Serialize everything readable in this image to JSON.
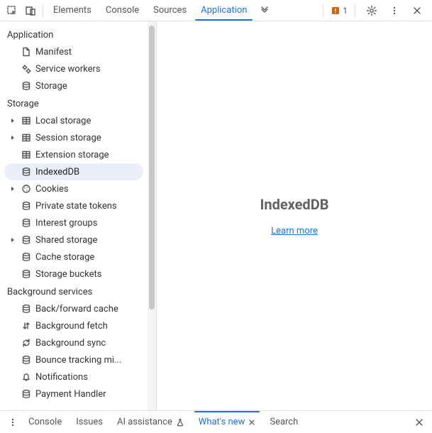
{
  "topbar": {
    "tabs": [
      "Elements",
      "Console",
      "Sources",
      "Application"
    ],
    "activeTabIndex": 3,
    "issueCount": "1"
  },
  "sidebar": {
    "groups": [
      {
        "title": "Application",
        "items": [
          {
            "label": "Manifest",
            "icon": "file",
            "expandable": false
          },
          {
            "label": "Service workers",
            "icon": "gears",
            "expandable": false
          },
          {
            "label": "Storage",
            "icon": "db",
            "expandable": false
          }
        ]
      },
      {
        "title": "Storage",
        "items": [
          {
            "label": "Local storage",
            "icon": "table",
            "expandable": true
          },
          {
            "label": "Session storage",
            "icon": "table",
            "expandable": true
          },
          {
            "label": "Extension storage",
            "icon": "table",
            "expandable": false
          },
          {
            "label": "IndexedDB",
            "icon": "db",
            "expandable": false,
            "selected": true
          },
          {
            "label": "Cookies",
            "icon": "cookie",
            "expandable": true
          },
          {
            "label": "Private state tokens",
            "icon": "db",
            "expandable": false
          },
          {
            "label": "Interest groups",
            "icon": "db",
            "expandable": false
          },
          {
            "label": "Shared storage",
            "icon": "db",
            "expandable": true
          },
          {
            "label": "Cache storage",
            "icon": "db",
            "expandable": false
          },
          {
            "label": "Storage buckets",
            "icon": "db",
            "expandable": false
          }
        ]
      },
      {
        "title": "Background services",
        "items": [
          {
            "label": "Back/forward cache",
            "icon": "db",
            "expandable": false
          },
          {
            "label": "Background fetch",
            "icon": "fetch",
            "expandable": false
          },
          {
            "label": "Background sync",
            "icon": "sync",
            "expandable": false
          },
          {
            "label": "Bounce tracking mi...",
            "icon": "db",
            "expandable": false
          },
          {
            "label": "Notifications",
            "icon": "bell",
            "expandable": false
          },
          {
            "label": "Payment Handler",
            "icon": "db",
            "expandable": false
          }
        ]
      }
    ]
  },
  "content": {
    "title": "IndexedDB",
    "linkText": "Learn more"
  },
  "drawer": {
    "tabs": [
      {
        "label": "Console",
        "active": false,
        "closable": false
      },
      {
        "label": "Issues",
        "active": false,
        "closable": false
      },
      {
        "label": "AI assistance",
        "active": false,
        "closable": false,
        "icon": "flask"
      },
      {
        "label": "What's new",
        "active": true,
        "closable": true
      },
      {
        "label": "Search",
        "active": false,
        "closable": false
      }
    ]
  }
}
